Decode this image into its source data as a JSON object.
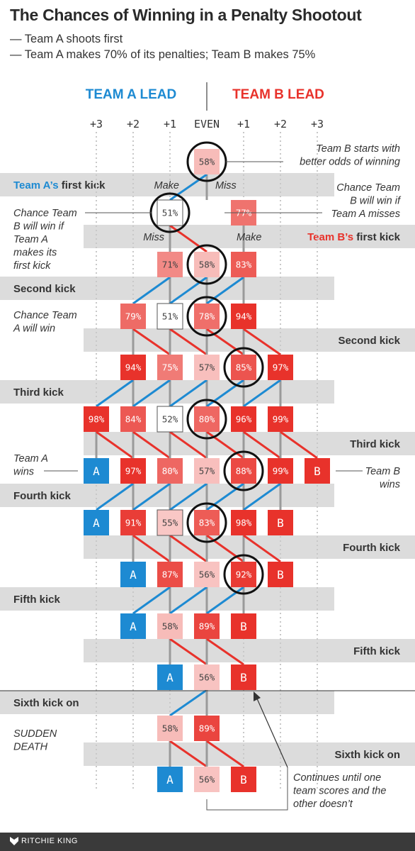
{
  "title": "The Chances of Winning in a Penalty Shootout",
  "subtitle_lines": [
    "— Team A shoots first",
    "— Team A makes 70% of its penalties; Team B makes 75%"
  ],
  "header": {
    "team_a_lead": "TEAM A LEAD",
    "team_b_lead": "TEAM B LEAD",
    "columns": [
      "+3",
      "+2",
      "+1",
      "EVEN",
      "+1",
      "+2",
      "+3"
    ]
  },
  "colors": {
    "team_a": "#1d8ad2",
    "team_b": "#e8322b",
    "band": "#dcdcdc",
    "track": "#c8c8c8",
    "neutral_text": "#444444"
  },
  "kick_labels": [
    {
      "team": "A",
      "label": "Team A’s first kick",
      "prefix": "Team A’s",
      "suffix": " first kick",
      "side": "left"
    },
    {
      "team": "B",
      "label": "Team B’s first kick",
      "prefix": "Team B’s",
      "suffix": " first kick",
      "side": "right"
    },
    {
      "team": "A",
      "label": "Second kick",
      "side": "left"
    },
    {
      "team": "B",
      "label": "Second kick",
      "side": "right"
    },
    {
      "team": "A",
      "label": "Third kick",
      "side": "left"
    },
    {
      "team": "B",
      "label": "Third kick",
      "side": "right"
    },
    {
      "team": "A",
      "label": "Fourth kick",
      "side": "left"
    },
    {
      "team": "B",
      "label": "Fourth kick",
      "side": "right"
    },
    {
      "team": "A",
      "label": "Fifth kick",
      "side": "left"
    },
    {
      "team": "B",
      "label": "Fifth kick",
      "side": "right"
    },
    {
      "team": "A",
      "label": "Sixth kick on",
      "side": "left"
    },
    {
      "team": "B",
      "label": "Sixth kick on",
      "side": "right"
    }
  ],
  "chart_data": {
    "type": "table",
    "description_columns": [
      "+3 A",
      "+2 A",
      "+1 A",
      "EVEN",
      "+1 B",
      "+2 B",
      "+3 B"
    ],
    "value_unit": "Chance Team B will win (%)",
    "rows": [
      {
        "cells": [
          {
            "col": 3,
            "text": "58%",
            "value": 58,
            "circled": true
          }
        ]
      },
      {
        "cells": [
          {
            "col": 2,
            "text": "51%",
            "value": 51,
            "circled": true
          },
          {
            "col": 4,
            "text": "77%",
            "value": 77
          }
        ]
      },
      {
        "cells": [
          {
            "col": 2,
            "text": "71%",
            "value": 71
          },
          {
            "col": 3,
            "text": "58%",
            "value": 58,
            "circled": true
          },
          {
            "col": 4,
            "text": "83%",
            "value": 83
          }
        ]
      },
      {
        "cells": [
          {
            "col": 1,
            "text": "79%",
            "value": 79
          },
          {
            "col": 2,
            "text": "51%",
            "value": 51
          },
          {
            "col": 3,
            "text": "78%",
            "value": 78,
            "circled": true
          },
          {
            "col": 4,
            "text": "94%",
            "value": 94
          }
        ]
      },
      {
        "cells": [
          {
            "col": 1,
            "text": "94%",
            "value": 94
          },
          {
            "col": 2,
            "text": "75%",
            "value": 75
          },
          {
            "col": 3,
            "text": "57%",
            "value": 57
          },
          {
            "col": 4,
            "text": "85%",
            "value": 85,
            "circled": true
          },
          {
            "col": 5,
            "text": "97%",
            "value": 97
          }
        ]
      },
      {
        "cells": [
          {
            "col": 0,
            "text": "98%",
            "value": 98
          },
          {
            "col": 1,
            "text": "84%",
            "value": 84
          },
          {
            "col": 2,
            "text": "52%",
            "value": 52
          },
          {
            "col": 3,
            "text": "80%",
            "value": 80,
            "circled": true
          },
          {
            "col": 4,
            "text": "96%",
            "value": 96
          },
          {
            "col": 5,
            "text": "99%",
            "value": 99
          }
        ]
      },
      {
        "cells": [
          {
            "col": 0,
            "text": "A",
            "terminal": "A"
          },
          {
            "col": 1,
            "text": "97%",
            "value": 97
          },
          {
            "col": 2,
            "text": "80%",
            "value": 80
          },
          {
            "col": 3,
            "text": "57%",
            "value": 57
          },
          {
            "col": 4,
            "text": "88%",
            "value": 88,
            "circled": true
          },
          {
            "col": 5,
            "text": "99%",
            "value": 99
          },
          {
            "col": 6,
            "text": "B",
            "terminal": "B"
          }
        ]
      },
      {
        "cells": [
          {
            "col": 0,
            "text": "A",
            "terminal": "A"
          },
          {
            "col": 1,
            "text": "91%",
            "value": 91
          },
          {
            "col": 2,
            "text": "55%",
            "value": 55
          },
          {
            "col": 3,
            "text": "83%",
            "value": 83,
            "circled": true
          },
          {
            "col": 4,
            "text": "98%",
            "value": 98
          },
          {
            "col": 5,
            "text": "B",
            "terminal": "B"
          }
        ]
      },
      {
        "cells": [
          {
            "col": 1,
            "text": "A",
            "terminal": "A"
          },
          {
            "col": 2,
            "text": "87%",
            "value": 87
          },
          {
            "col": 3,
            "text": "56%",
            "value": 56
          },
          {
            "col": 4,
            "text": "92%",
            "value": 92,
            "circled": true
          },
          {
            "col": 5,
            "text": "B",
            "terminal": "B"
          }
        ]
      },
      {
        "cells": [
          {
            "col": 1,
            "text": "A",
            "terminal": "A"
          },
          {
            "col": 2,
            "text": "58%",
            "value": 58
          },
          {
            "col": 3,
            "text": "89%",
            "value": 89
          },
          {
            "col": 4,
            "text": "B",
            "terminal": "B"
          }
        ]
      },
      {
        "cells": [
          {
            "col": 2,
            "text": "A",
            "terminal": "A"
          },
          {
            "col": 3,
            "text": "56%",
            "value": 56
          },
          {
            "col": 4,
            "text": "B",
            "terminal": "B"
          }
        ]
      },
      {
        "cells": [
          {
            "col": 2,
            "text": "58%",
            "value": 58
          },
          {
            "col": 3,
            "text": "89%",
            "value": 89
          }
        ]
      },
      {
        "cells": [
          {
            "col": 2,
            "text": "A",
            "terminal": "A"
          },
          {
            "col": 3,
            "text": "56%",
            "value": 56
          },
          {
            "col": 4,
            "text": "B",
            "terminal": "B"
          }
        ]
      }
    ]
  },
  "annotations": {
    "make_a": "Make",
    "miss_a": "Miss",
    "miss_b": "Miss",
    "make_b": "Make",
    "team_b_odds": [
      "Team B starts with",
      "better odds of winning"
    ],
    "team_b_win_if_miss": [
      "Chance Team",
      "B will win if",
      "Team A misses"
    ],
    "team_b_win_if_make": [
      "Chance Team",
      "B will win if",
      "Team A",
      "makes its",
      "first kick"
    ],
    "team_a_win": [
      "Chance Team",
      "A will win"
    ],
    "team_a_wins": [
      "Team A",
      "wins"
    ],
    "team_b_wins": [
      "Team B",
      "wins"
    ],
    "sudden_death": [
      "SUDDEN",
      "DEATH"
    ],
    "continues": [
      "Continues until one",
      "team scores and the",
      "other doesn’t"
    ]
  },
  "footer": {
    "credit": "RITCHIE KING",
    "logo_icon": "fox-icon"
  }
}
